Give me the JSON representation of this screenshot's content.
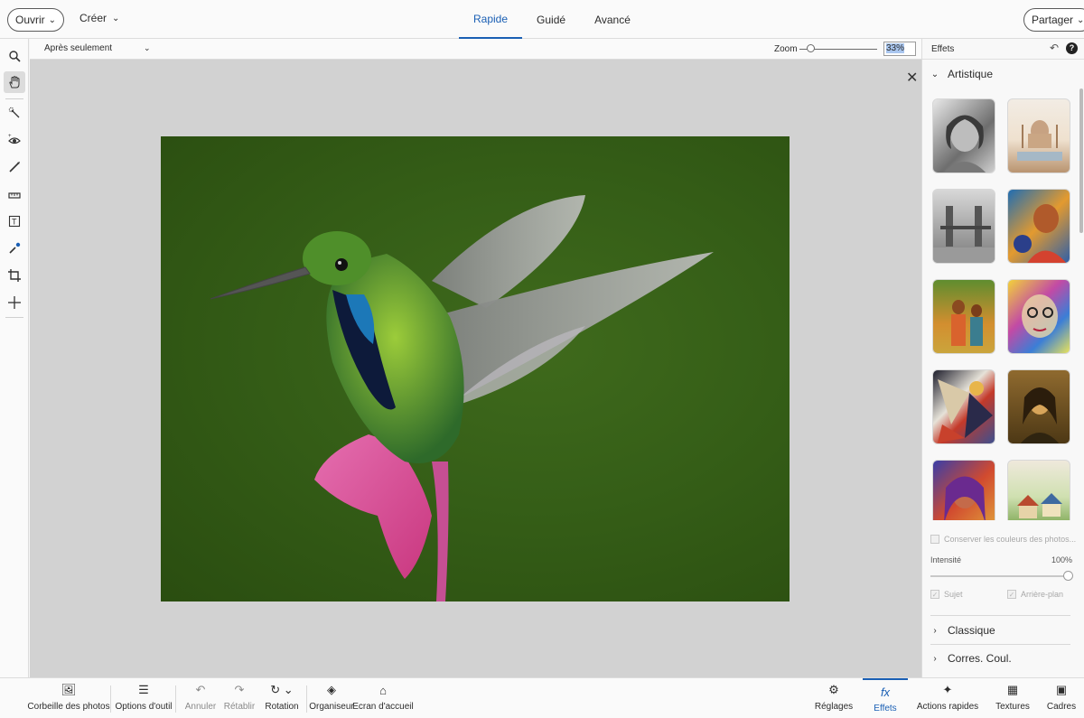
{
  "topbar": {
    "open_label": "Ouvrir",
    "create_label": "Créer",
    "tabs": [
      {
        "label": "Rapide",
        "active": true
      },
      {
        "label": "Guidé",
        "active": false
      },
      {
        "label": "Avancé",
        "active": false
      }
    ],
    "share_label": "Partager"
  },
  "left_tools": [
    {
      "icon": "zoom-icon"
    },
    {
      "icon": "hand-icon",
      "active": true
    },
    {
      "icon": "quick-selection-icon"
    },
    {
      "icon": "red-eye-icon"
    },
    {
      "icon": "whiten-teeth-icon"
    },
    {
      "icon": "straighten-icon"
    },
    {
      "icon": "text-icon"
    },
    {
      "icon": "spot-healing-icon"
    },
    {
      "icon": "crop-icon"
    },
    {
      "icon": "move-icon"
    }
  ],
  "options_bar": {
    "view_mode": "Après seulement",
    "zoom_label": "Zoom",
    "zoom_value": "33%",
    "zoom_fraction": 0.1
  },
  "right_panel": {
    "title": "Effets",
    "section_artistic": "Artistique",
    "effect_thumbnails": [
      "sketch-portrait",
      "taj-mahal-watercolor",
      "bridge-sketch",
      "colorful-portrait",
      "gauguin-style",
      "abstract-face",
      "cubist-abstract",
      "mona-lisa-style",
      "colorful-portrait-2",
      "village-illustration"
    ],
    "preserve_colors_label": "Conserver les couleurs des photos...",
    "intensity_label": "Intensité",
    "intensity_value": "100%",
    "intensity_fraction": 1.0,
    "subject_label": "Sujet",
    "background_label": "Arrière-plan",
    "section_classic": "Classique",
    "section_color_match": "Corres. Coul."
  },
  "bottom_bar": {
    "photo_bin": "Corbeille des photos",
    "tool_options": "Options d'outil",
    "undo": "Annuler",
    "redo": "Rétablir",
    "rotate": "Rotation",
    "organizer": "Organiseur",
    "home": "Ecran d'accueil",
    "adjustments": "Réglages",
    "effects": "Effets",
    "quick_actions": "Actions rapides",
    "textures": "Textures",
    "frames": "Cadres"
  },
  "colors": {
    "accent": "#1a5fb4",
    "canvas_bg": "#d2d2d2",
    "photo_bg": "#355e17"
  }
}
